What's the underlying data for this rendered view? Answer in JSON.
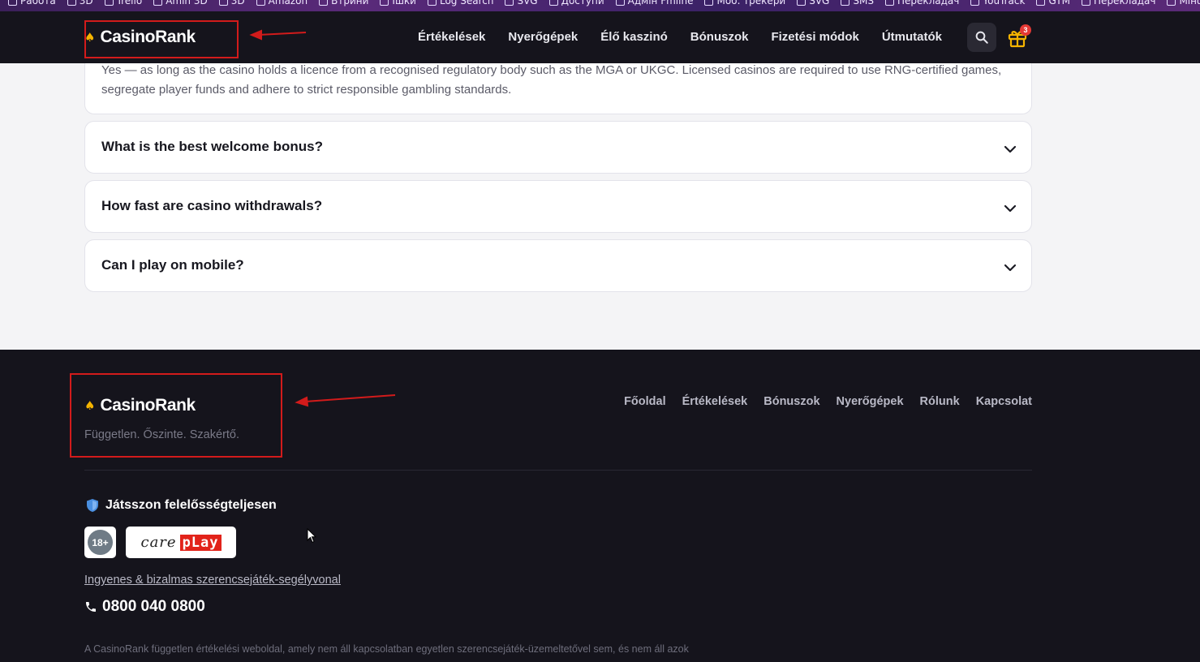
{
  "bookmarks": [
    "Работа",
    "3D",
    "Trello",
    "Amin 3D",
    "3D",
    "Amazon",
    "Втрини",
    "Ішки",
    "Log Search",
    "SVG",
    "Доступи",
    "Адмін Fmline",
    "Моб. трекери",
    "SVG",
    "SMS",
    "Перекладач",
    "YouTrack",
    "GTM",
    "Перекладач",
    "Мінфін"
  ],
  "header": {
    "logo_text": "CasinoRank",
    "nav": [
      "Értékelések",
      "Nyerőgépek",
      "Élő kaszinó",
      "Bónuszok",
      "Fizetési módok",
      "Útmutatók"
    ],
    "gift_badge": "3"
  },
  "faq": {
    "open_answer": "Yes — as long as the casino holds a licence from a recognised regulatory body such as the MGA or UKGC. Licensed casinos are required to use RNG-certified games, segregate player funds and adhere to strict responsible gambling standards.",
    "questions": [
      "What is the best welcome bonus?",
      "How fast are casino withdrawals?",
      "Can I play on mobile?"
    ]
  },
  "footer": {
    "logo_text": "CasinoRank",
    "tagline": "Független. Őszinte. Szakértő.",
    "nav": [
      "Főoldal",
      "Értékelések",
      "Bónuszok",
      "Nyerőgépek",
      "Rólunk",
      "Kapcsolat"
    ],
    "responsible_title": "Játsszon felelősségteljesen",
    "age_badge": "18+",
    "careplay_left": "care",
    "careplay_right": "pLay",
    "helpline_link": "Ingyenes & bizalmas szerencsejáték-segélyvonal",
    "phone": "0800 040 0800",
    "disclaimer": "A CasinoRank független értékelési weboldal, amely nem áll kapcsolatban egyetlen szerencsejáték-üzemeltetővel sem, és nem áll azok"
  },
  "colors": {
    "accent": "#f5b400",
    "dark_bg": "#15141c",
    "annotation": "#d21b1b",
    "badge": "#e53935"
  }
}
